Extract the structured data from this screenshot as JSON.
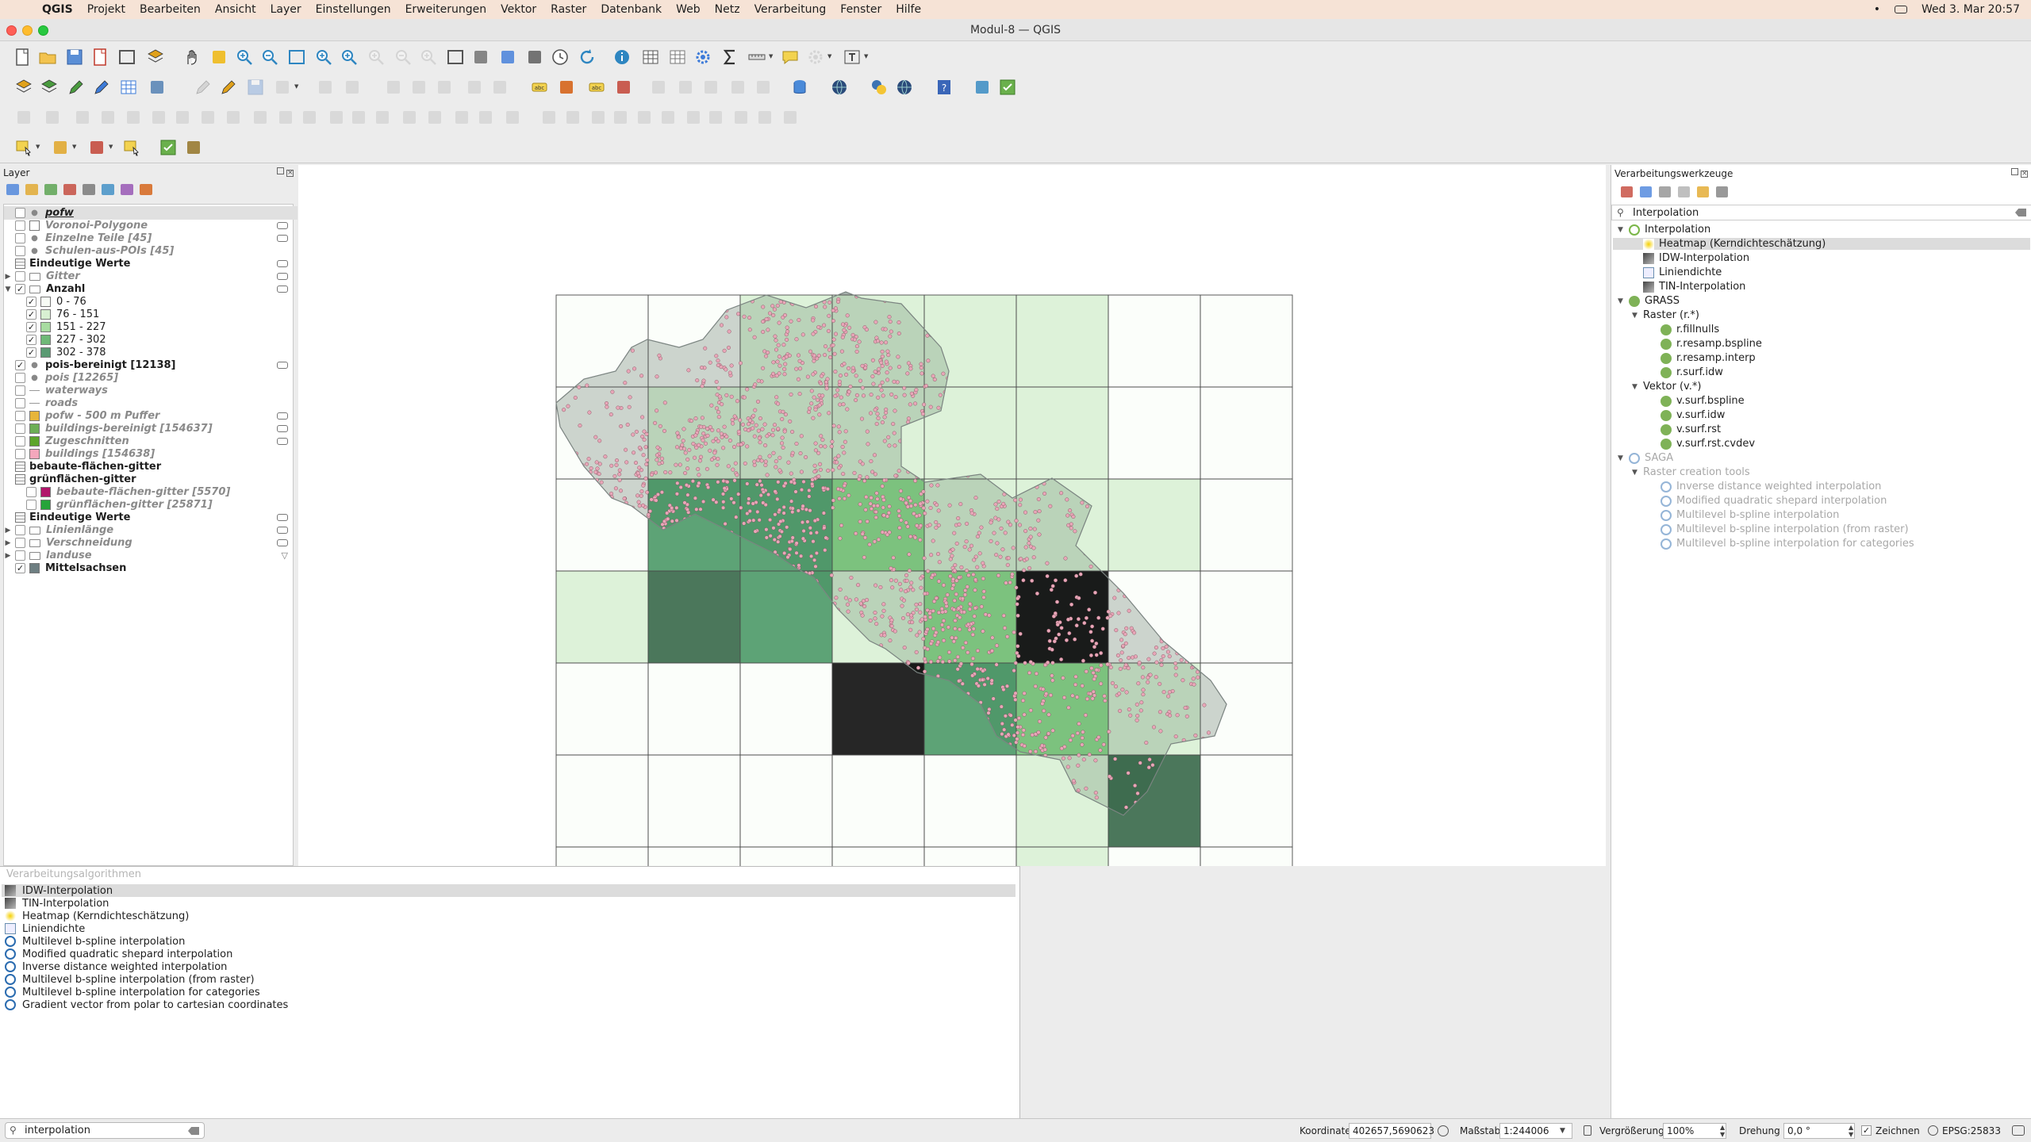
{
  "menubar": {
    "app_name": "QGIS",
    "items": [
      "Projekt",
      "Bearbeiten",
      "Ansicht",
      "Layer",
      "Einstellungen",
      "Erweiterungen",
      "Vektor",
      "Raster",
      "Datenbank",
      "Web",
      "Netz",
      "Verarbeitung",
      "Fenster",
      "Hilfe"
    ],
    "clock": "Wed 3. Mar  20:57"
  },
  "window": {
    "title": "Modul-8 — QGIS"
  },
  "layers_panel": {
    "title": "Layer",
    "rows": [
      {
        "label": "pofw",
        "checked": false,
        "style": "bolditalicunder",
        "sym": "dot",
        "indent": 0,
        "expand": ""
      },
      {
        "label": "Voronoi-Polygone",
        "checked": false,
        "style": "italic",
        "sym": "box",
        "indent": 0,
        "expand": ""
      },
      {
        "label": "Einzelne Teile [45]",
        "checked": false,
        "style": "italic",
        "sym": "dot",
        "indent": 0,
        "expand": ""
      },
      {
        "label": "Schulen-aus-POIs [45]",
        "checked": false,
        "style": "italic",
        "sym": "dot",
        "indent": 0,
        "expand": ""
      },
      {
        "label": "Eindeutige Werte",
        "checked": null,
        "style": "bold",
        "sym": "grid",
        "indent": 0,
        "expand": ""
      },
      {
        "label": "Gitter",
        "checked": false,
        "style": "italic",
        "sym": "group",
        "indent": 0,
        "expand": "▶"
      },
      {
        "label": "Anzahl",
        "checked": true,
        "style": "bold",
        "sym": "group",
        "indent": 0,
        "expand": "▼"
      },
      {
        "label": "0 - 76",
        "checked": true,
        "style": "normal",
        "sym": "c1",
        "indent": 1,
        "expand": ""
      },
      {
        "label": "76 - 151",
        "checked": true,
        "style": "normal",
        "sym": "c2",
        "indent": 1,
        "expand": ""
      },
      {
        "label": "151 - 227",
        "checked": true,
        "style": "normal",
        "sym": "c3",
        "indent": 1,
        "expand": ""
      },
      {
        "label": "227 - 302",
        "checked": true,
        "style": "normal",
        "sym": "c4",
        "indent": 1,
        "expand": ""
      },
      {
        "label": "302 - 378",
        "checked": true,
        "style": "normal",
        "sym": "c5",
        "indent": 1,
        "expand": ""
      },
      {
        "label": "pois-bereinigt [12138]",
        "checked": true,
        "style": "bold",
        "sym": "dot",
        "indent": 0,
        "expand": ""
      },
      {
        "label": "pois [12265]",
        "checked": false,
        "style": "italic",
        "sym": "dot",
        "indent": 0,
        "expand": ""
      },
      {
        "label": "waterways",
        "checked": false,
        "style": "italic",
        "sym": "line",
        "indent": 0,
        "expand": ""
      },
      {
        "label": "roads",
        "checked": false,
        "style": "italic",
        "sym": "line",
        "indent": 0,
        "expand": ""
      },
      {
        "label": "pofw - 500 m Puffer",
        "checked": false,
        "style": "italic",
        "sym": "yellow",
        "indent": 0,
        "expand": ""
      },
      {
        "label": "buildings-bereinigt [154637]",
        "checked": false,
        "style": "italic",
        "sym": "green",
        "indent": 0,
        "expand": ""
      },
      {
        "label": "Zugeschnitten",
        "checked": false,
        "style": "italic",
        "sym": "lime",
        "indent": 0,
        "expand": ""
      },
      {
        "label": "buildings [154638]",
        "checked": false,
        "style": "italic",
        "sym": "pink",
        "indent": 0,
        "expand": ""
      },
      {
        "label": "bebaute-flächen-gitter",
        "checked": null,
        "style": "bold",
        "sym": "grid",
        "indent": 0,
        "expand": ""
      },
      {
        "label": "grünflächen-gitter",
        "checked": null,
        "style": "bold",
        "sym": "grid",
        "indent": 0,
        "expand": ""
      },
      {
        "label": "bebaute-flächen-gitter [5570]",
        "checked": false,
        "style": "italic",
        "sym": "magenta",
        "indent": 1,
        "expand": ""
      },
      {
        "label": "grünflächen-gitter [25871]",
        "checked": false,
        "style": "italic",
        "sym": "dgreen",
        "indent": 1,
        "expand": ""
      },
      {
        "label": "Eindeutige Werte",
        "checked": null,
        "style": "bold",
        "sym": "grid",
        "indent": 0,
        "expand": ""
      },
      {
        "label": "Linienlänge",
        "checked": false,
        "style": "italic",
        "sym": "group",
        "indent": 0,
        "expand": "▶"
      },
      {
        "label": "Verschneidung",
        "checked": false,
        "style": "italic",
        "sym": "group",
        "indent": 0,
        "expand": "▶"
      },
      {
        "label": "landuse",
        "checked": false,
        "style": "italic",
        "sym": "group",
        "indent": 0,
        "expand": "▶"
      },
      {
        "label": "Mittelsachsen",
        "checked": true,
        "style": "bold",
        "sym": "slate",
        "indent": 0,
        "expand": ""
      }
    ]
  },
  "algorithm_list": {
    "placeholder": "Verarbeitungsalgorithmen",
    "items": [
      {
        "label": "IDW-Interpolation",
        "icon": "raster",
        "selected": true
      },
      {
        "label": "TIN-Interpolation",
        "icon": "raster",
        "selected": false
      },
      {
        "label": "Heatmap (Kerndichteschätzung)",
        "icon": "heat",
        "selected": false
      },
      {
        "label": "Liniendichte",
        "icon": "line",
        "selected": false
      },
      {
        "label": "Multilevel b-spline interpolation",
        "icon": "saga",
        "selected": false
      },
      {
        "label": "Modified quadratic shepard interpolation",
        "icon": "saga",
        "selected": false
      },
      {
        "label": "Inverse distance weighted interpolation",
        "icon": "saga",
        "selected": false
      },
      {
        "label": "Multilevel b-spline interpolation (from raster)",
        "icon": "saga",
        "selected": false
      },
      {
        "label": "Multilevel b-spline interpolation for categories",
        "icon": "saga",
        "selected": false
      },
      {
        "label": "Gradient vector from polar to cartesian coordinates",
        "icon": "saga",
        "selected": false
      }
    ]
  },
  "locator": {
    "value": "interpolation"
  },
  "toolbox": {
    "title": "Verarbeitungswerkzeuge",
    "search_value": "Interpolation",
    "tree": [
      {
        "label": "Interpolation",
        "level": 0,
        "expand": "▼",
        "icon": "qgis",
        "dim": false,
        "selected": false
      },
      {
        "label": "Heatmap (Kerndichteschätzung)",
        "level": 2,
        "expand": "",
        "icon": "heat",
        "dim": false,
        "selected": true
      },
      {
        "label": "IDW-Interpolation",
        "level": 2,
        "expand": "",
        "icon": "raster",
        "dim": false,
        "selected": false
      },
      {
        "label": "Liniendichte",
        "level": 2,
        "expand": "",
        "icon": "line",
        "dim": false,
        "selected": false
      },
      {
        "label": "TIN-Interpolation",
        "level": 2,
        "expand": "",
        "icon": "raster",
        "dim": false,
        "selected": false
      },
      {
        "label": "GRASS",
        "level": 0,
        "expand": "▼",
        "icon": "grass",
        "dim": false,
        "selected": false
      },
      {
        "label": "Raster (r.*)",
        "level": 1,
        "expand": "▼",
        "icon": "",
        "dim": false,
        "selected": false
      },
      {
        "label": "r.fillnulls",
        "level": 3,
        "expand": "",
        "icon": "grass",
        "dim": false,
        "selected": false
      },
      {
        "label": "r.resamp.bspline",
        "level": 3,
        "expand": "",
        "icon": "grass",
        "dim": false,
        "selected": false
      },
      {
        "label": "r.resamp.interp",
        "level": 3,
        "expand": "",
        "icon": "grass",
        "dim": false,
        "selected": false
      },
      {
        "label": "r.surf.idw",
        "level": 3,
        "expand": "",
        "icon": "grass",
        "dim": false,
        "selected": false
      },
      {
        "label": "Vektor (v.*)",
        "level": 1,
        "expand": "▼",
        "icon": "",
        "dim": false,
        "selected": false
      },
      {
        "label": "v.surf.bspline",
        "level": 3,
        "expand": "",
        "icon": "grass",
        "dim": false,
        "selected": false
      },
      {
        "label": "v.surf.idw",
        "level": 3,
        "expand": "",
        "icon": "grass",
        "dim": false,
        "selected": false
      },
      {
        "label": "v.surf.rst",
        "level": 3,
        "expand": "",
        "icon": "grass",
        "dim": false,
        "selected": false
      },
      {
        "label": "v.surf.rst.cvdev",
        "level": 3,
        "expand": "",
        "icon": "grass",
        "dim": false,
        "selected": false
      },
      {
        "label": "SAGA",
        "level": 0,
        "expand": "▼",
        "icon": "saga",
        "dim": true,
        "selected": false
      },
      {
        "label": "Raster creation tools",
        "level": 1,
        "expand": "▼",
        "icon": "",
        "dim": true,
        "selected": false
      },
      {
        "label": "Inverse distance weighted interpolation",
        "level": 3,
        "expand": "",
        "icon": "saga",
        "dim": true,
        "selected": false
      },
      {
        "label": "Modified quadratic shepard interpolation",
        "level": 3,
        "expand": "",
        "icon": "saga",
        "dim": true,
        "selected": false
      },
      {
        "label": "Multilevel b-spline interpolation",
        "level": 3,
        "expand": "",
        "icon": "saga",
        "dim": true,
        "selected": false
      },
      {
        "label": "Multilevel b-spline interpolation (from raster)",
        "level": 3,
        "expand": "",
        "icon": "saga",
        "dim": true,
        "selected": false
      },
      {
        "label": "Multilevel b-spline interpolation for categories",
        "level": 3,
        "expand": "",
        "icon": "saga",
        "dim": true,
        "selected": false
      }
    ]
  },
  "statusbar": {
    "coord_label": "Koordinate",
    "coord_value": "402657,5690623",
    "scale_label": "Maßstab",
    "scale_value": "1:244006",
    "mag_label": "Vergrößerung",
    "mag_value": "100%",
    "rot_label": "Drehung",
    "rot_value": "0,0 °",
    "render_label": "Zeichnen",
    "crs_label": "EPSG:25833"
  },
  "colors": {
    "class_0_76": "#f7fcf5",
    "class_76_151": "#c7e9c0",
    "class_151_227": "#74c476",
    "class_227_302": "#41935e",
    "class_302_378": "#2c5f3e",
    "region_fill": "#a9b2ae",
    "poi": "#e8a6b8"
  },
  "grid_classes": [
    [
      0,
      0,
      1,
      1,
      1,
      1,
      0,
      0
    ],
    [
      0,
      1,
      1,
      1,
      1,
      1,
      0,
      0
    ],
    [
      0,
      3,
      3,
      2,
      1,
      1,
      1,
      0
    ],
    [
      1,
      4,
      3,
      1,
      2,
      5,
      0,
      0
    ],
    [
      0,
      0,
      0,
      5,
      3,
      2,
      1,
      0
    ],
    [
      0,
      0,
      0,
      0,
      0,
      1,
      4,
      0
    ],
    [
      0,
      0,
      0,
      0,
      0,
      1,
      0,
      0
    ]
  ]
}
